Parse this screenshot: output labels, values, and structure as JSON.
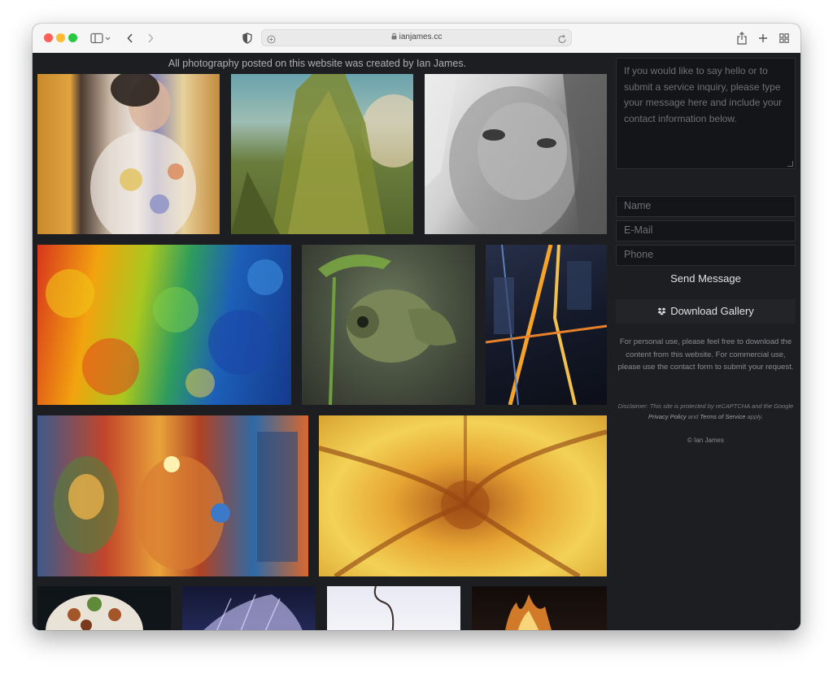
{
  "browser": {
    "url": "ianjames.cc",
    "icons": {
      "sidebar": "sidebar-icon",
      "back": "chevron-left-icon",
      "forward": "chevron-right-icon",
      "privacy": "shield-icon",
      "share": "share-icon",
      "new_tab": "plus-icon",
      "tabs": "tab-overview-icon",
      "lock": "lock-icon",
      "reload": "reload-icon"
    }
  },
  "page": {
    "notice": "All photography posted on this website was created by Ian James."
  },
  "gallery": {
    "items": [
      {
        "name": "photo-woman-floral-shirt",
        "desc": "woman in floral shirt"
      },
      {
        "name": "photo-tree-canopy",
        "desc": "tree canopy"
      },
      {
        "name": "photo-freckled-face",
        "desc": "freckled face black and white"
      },
      {
        "name": "photo-color-splash",
        "desc": "colorful paint splash"
      },
      {
        "name": "photo-chameleon",
        "desc": "chameleon on plant"
      },
      {
        "name": "photo-city-night",
        "desc": "city at night aerial"
      },
      {
        "name": "photo-street-art",
        "desc": "street art mural"
      },
      {
        "name": "photo-fractal",
        "desc": "yellow fractal"
      },
      {
        "name": "photo-lamp",
        "desc": "patterned lamp"
      },
      {
        "name": "photo-jellyfish",
        "desc": "jellyfish"
      },
      {
        "name": "photo-light-bulb",
        "desc": "light on white"
      },
      {
        "name": "photo-fire",
        "desc": "fire"
      }
    ]
  },
  "contact": {
    "message_placeholder": "If you would like to say hello or to submit a service inquiry, please type your message here and include your contact information below.",
    "name_placeholder": "Name",
    "email_placeholder": "E-Mail",
    "phone_placeholder": "Phone",
    "send_label": "Send Message"
  },
  "download": {
    "label": "Download Gallery",
    "icon": "dropbox-icon"
  },
  "info": {
    "usage": "For personal use, please feel free to download the content from this website. For commercial use, please use the contact form to submit your request.",
    "disclaimer_prefix": "Disclaimer: This site is protected by reCAPTCHA and the Google",
    "privacy_link": "Privacy Policy",
    "and_text": "and",
    "terms_link": "Terms of Service",
    "disclaimer_suffix": "apply.",
    "copyright": "© Ian James"
  }
}
